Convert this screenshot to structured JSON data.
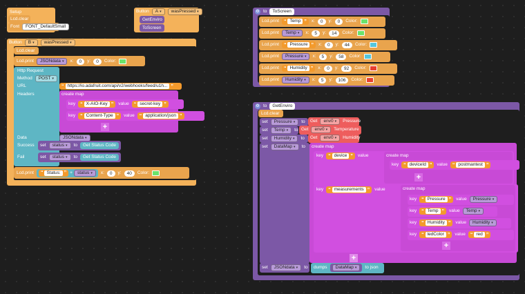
{
  "setup": {
    "title": "Setup",
    "lcd_clear": "Lcd.clear",
    "font_label": "Font",
    "font_value": "FONT_DefaultSmall"
  },
  "button_a": {
    "label": "Button",
    "button": "A",
    "event": "wasPressed",
    "call1": "GetEnviro",
    "call2": "ToScreen"
  },
  "button_b": {
    "label": "Button",
    "button": "B",
    "event": "wasPressed",
    "lcd_clear": "Lcd.clear",
    "print1": {
      "label": "Lcd.print",
      "var": "JSONdata",
      "x": "0",
      "y": "0",
      "color_label": "Color:",
      "color": "#6be36b"
    },
    "http": {
      "title": "Http Request",
      "method_label": "Method",
      "method": "POST",
      "url_label": "URL",
      "url": "https://io.adafruit.com/api/v2/webhooks/feed/u1h...",
      "headers_label": "Headers",
      "create_map": "create map",
      "h1": {
        "key": "X-AIO-Key",
        "value": "secret-key"
      },
      "h2": {
        "key": "Content-Type",
        "value": "application/json"
      },
      "data_label": "Data",
      "data_var": "JSONdata",
      "success_label": "Success",
      "fail_label": "Fail",
      "set": "set",
      "status_var": "status",
      "to": "to",
      "get_status": "Get Status Code"
    },
    "print2": {
      "label": "Lcd.print",
      "text": "Status:",
      "plus": "+",
      "var": "status",
      "x": "0",
      "y": "40",
      "color_label": "Color:",
      "color": "#6be36b"
    }
  },
  "common": {
    "key": "key",
    "value": "value",
    "x": "x:",
    "y": "y:",
    "plus_sign": "+"
  },
  "to_screen": {
    "title": "to",
    "name": "ToScreen",
    "rows": [
      {
        "label": "Lcd.print",
        "kind": "str",
        "val": "Temp",
        "x": "0",
        "y": "0",
        "color": "#6be36b"
      },
      {
        "label": "Lcd.print",
        "kind": "var",
        "val": "Temp",
        "x": "5",
        "y": "14",
        "color": "#6be36b"
      },
      {
        "label": "Lcd.print",
        "kind": "str",
        "val": "Pressure",
        "x": "0",
        "y": "44",
        "color": "#55c6dc"
      },
      {
        "label": "Lcd.print",
        "kind": "var",
        "val": "Pressure",
        "x": "5",
        "y": "58",
        "color": "#55c6dc"
      },
      {
        "label": "Lcd.print",
        "kind": "str",
        "val": "Humidity",
        "x": "0",
        "y": "92",
        "color": "#e8402f"
      },
      {
        "label": "Lcd.print",
        "kind": "var",
        "val": "Humidity",
        "x": "5",
        "y": "106",
        "color": "#e8402f"
      }
    ],
    "color_label": "Color:"
  },
  "get_enviro": {
    "title": "to",
    "name": "GetEnviro",
    "lcd_clear": "Lcd.clear",
    "set": "set",
    "to": "to",
    "get": "Get",
    "sensor": "env0",
    "s1": {
      "var": "Pressure",
      "prop": "Pressure"
    },
    "s2": {
      "var": "Temp",
      "prop": "Temperature"
    },
    "s3": {
      "var": "Humidity",
      "prop": "Humidity"
    },
    "datamap_var": "DataMap",
    "create_map": "create map",
    "device_key": "device",
    "deviceid_key": "deviceId",
    "deviceid_val": "postmantest",
    "measure_key": "measurements",
    "m1": {
      "key": "Pressure",
      "val": "Pressure"
    },
    "m2": {
      "key": "Temp",
      "val": "Temp"
    },
    "m3": {
      "key": "Humidity",
      "val": "Humidity"
    },
    "m4": {
      "key": "ledColor",
      "val": "red"
    },
    "json_var": "JSONdata",
    "dumps": "dumps",
    "dumps_arg": "DataMap",
    "to_json": "to json"
  }
}
